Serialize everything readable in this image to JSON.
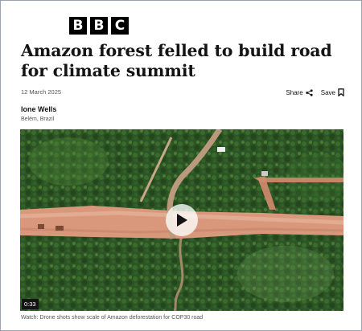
{
  "brand": {
    "letters": [
      "B",
      "B",
      "C"
    ]
  },
  "article": {
    "headline": "Amazon forest felled to build road for climate summit",
    "date": "12 March 2025",
    "author": "Ione Wells",
    "location": "Belém, Brazil"
  },
  "actions": {
    "share_label": "Share",
    "save_label": "Save",
    "share_icon": "share-icon",
    "save_icon": "bookmark-icon"
  },
  "video": {
    "duration": "0:33",
    "caption": "Watch: Drone shots show scale of Amazon deforestation for COP30 road",
    "play_icon": "play-icon"
  },
  "colors": {
    "text": "#141414",
    "muted": "#545658",
    "brand_block": "#000000",
    "forest": "#2f5a26",
    "cleared_earth": "#d9987c"
  }
}
